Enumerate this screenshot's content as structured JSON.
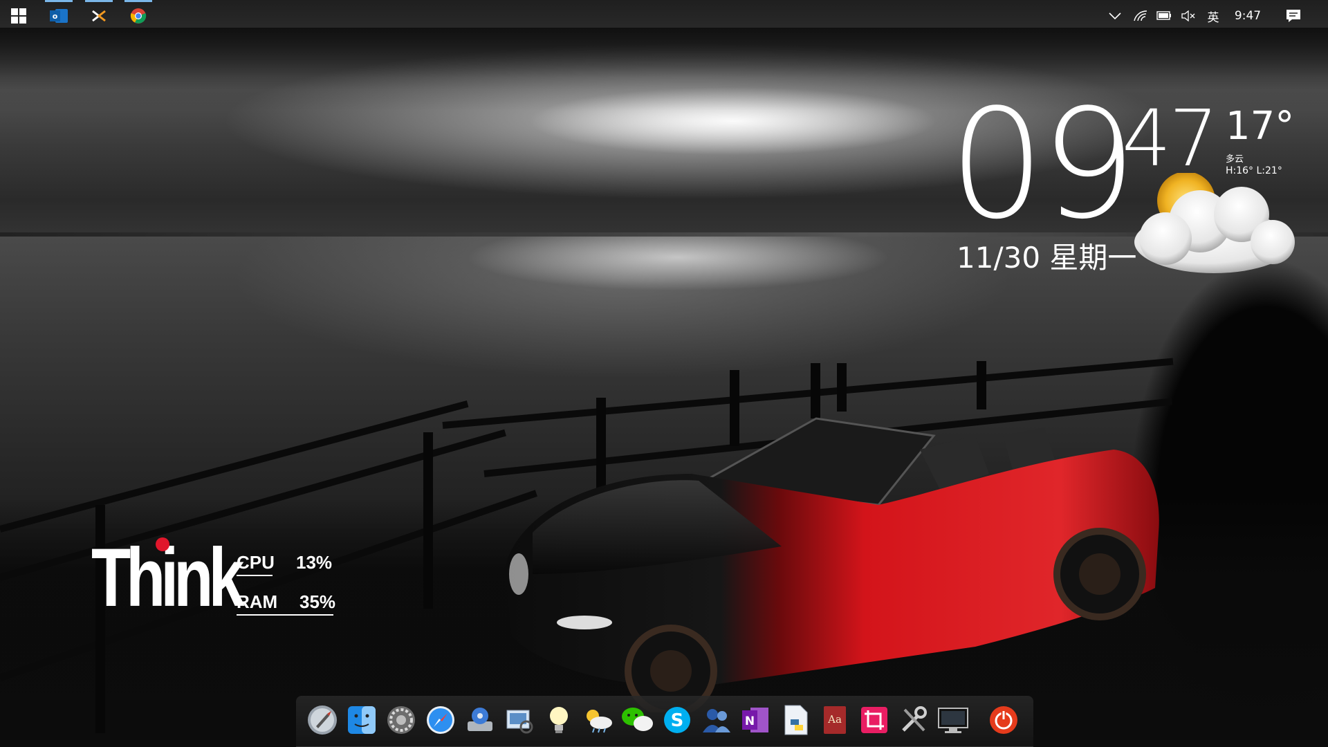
{
  "taskbar": {
    "start_icon": "windows-start-icon",
    "pinned": [
      {
        "name": "outlook",
        "icon": "outlook-icon",
        "active": true
      },
      {
        "name": "xmind",
        "icon": "xmind-icon",
        "active": true
      },
      {
        "name": "chrome",
        "icon": "chrome-icon",
        "active": true
      }
    ],
    "tray": {
      "language": "英",
      "time": "9:47"
    }
  },
  "clock_widget": {
    "hour": "09",
    "minute": "47",
    "date": "11/30 星期一",
    "temperature": "17°",
    "condition": "多云",
    "high_low": "H:16° L:21°",
    "weather_icon": "partly-cloudy-icon"
  },
  "think_widget": {
    "logo": "Think",
    "cpu_label": "CPU",
    "cpu_value": "13%",
    "ram_label": "RAM",
    "ram_value": "35%"
  },
  "dock": {
    "items": [
      "launchpad-icon",
      "finder-icon",
      "system-preferences-icon",
      "safari-icon",
      "disk-utility-icon",
      "preview-icon",
      "idea-bulb-icon",
      "weather-app-icon",
      "wechat-icon",
      "skype-icon",
      "contacts-icon",
      "onenote-icon",
      "python-file-icon",
      "dictionary-icon",
      "crop-tool-icon",
      "utilities-icon",
      "remote-desktop-icon",
      "power-icon"
    ]
  },
  "colors": {
    "accent": "#7ab6e8",
    "think_dot": "#e0162b",
    "car_red": "#d3141a"
  }
}
